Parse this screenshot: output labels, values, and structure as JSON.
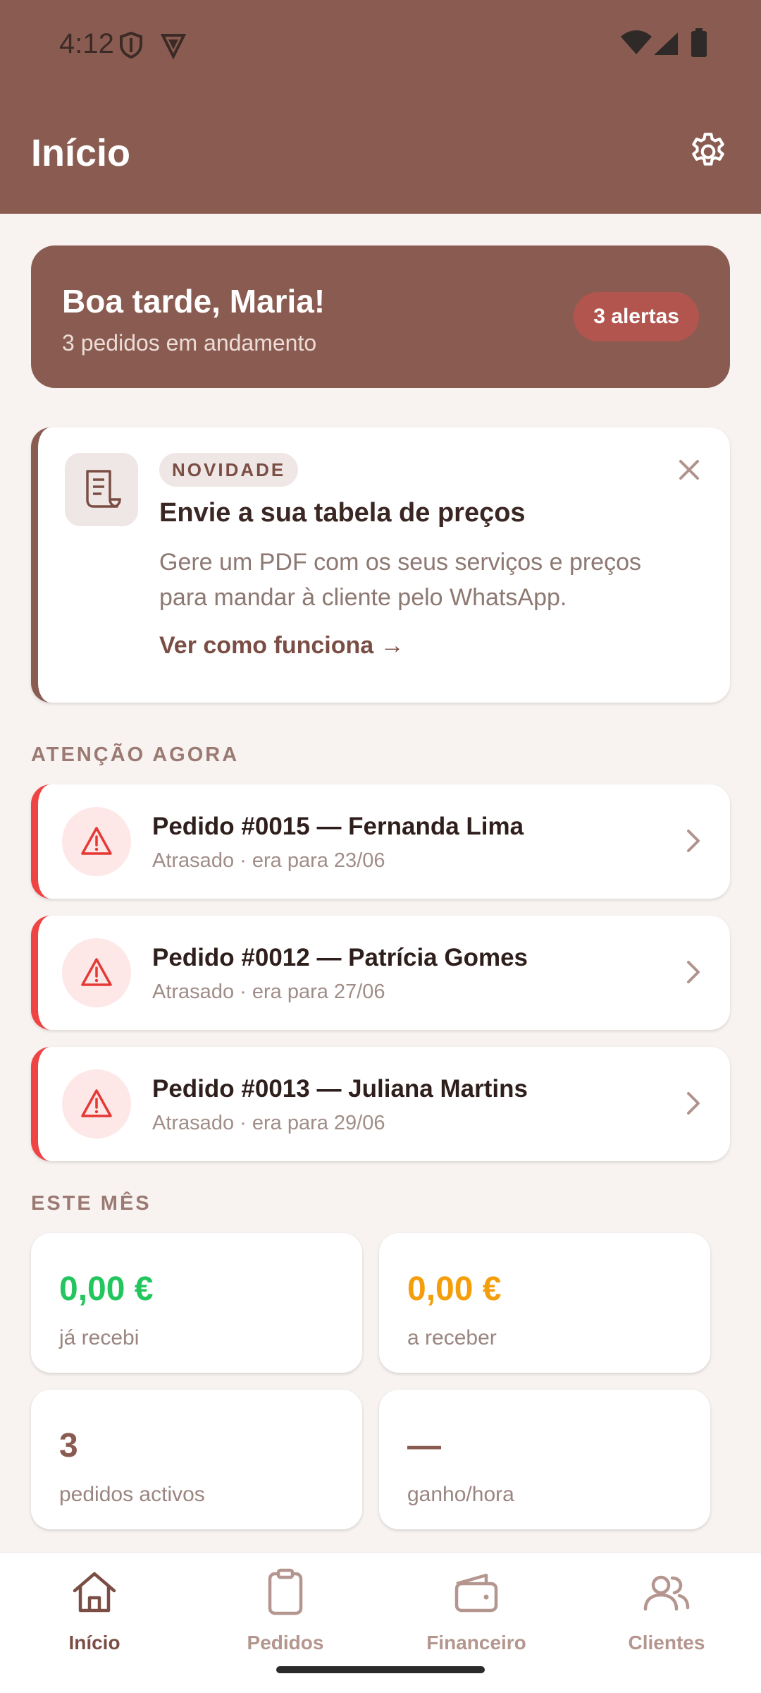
{
  "status_bar": {
    "time": "4:12"
  },
  "header": {
    "title": "Início"
  },
  "greeting": {
    "hello": "Boa tarde, Maria!",
    "subtitle": "3 pedidos em andamento",
    "badge": "3 alertas"
  },
  "promo": {
    "tag": "NOVIDADE",
    "title": "Envie a sua tabela de preços",
    "text": "Gere um PDF com os seus serviços e preços para mandar à cliente pelo WhatsApp.",
    "link": "Ver como funciona →"
  },
  "attention": {
    "label": "ATENÇÃO AGORA",
    "items": [
      {
        "title": "Pedido #0015 — Fernanda Lima",
        "subtitle": "Atrasado · era para 23/06"
      },
      {
        "title": "Pedido #0012 — Patrícia Gomes",
        "subtitle": "Atrasado · era para 27/06"
      },
      {
        "title": "Pedido #0013 — Juliana Martins",
        "subtitle": "Atrasado · era para 29/06"
      }
    ]
  },
  "month": {
    "label": "ESTE MÊS",
    "stats": [
      {
        "value": "0,00 €",
        "label": "já recebi",
        "color": "#22c55e"
      },
      {
        "value": "0,00 €",
        "label": "a receber",
        "color": "#f59e0b"
      },
      {
        "value": "3",
        "label": "pedidos activos",
        "color": "#8a5c51"
      },
      {
        "value": "—",
        "label": "ganho/hora",
        "color": "#8a5c51"
      }
    ]
  },
  "nav": {
    "items": [
      {
        "label": "Início",
        "icon": "home-icon",
        "active": true
      },
      {
        "label": "Pedidos",
        "icon": "clipboard-icon",
        "active": false
      },
      {
        "label": "Financeiro",
        "icon": "wallet-icon",
        "active": false
      },
      {
        "label": "Clientes",
        "icon": "users-icon",
        "active": false
      }
    ]
  },
  "colors": {
    "brand": "#8a5c51",
    "alert": "#ef4444",
    "background": "#f8f3f1"
  }
}
